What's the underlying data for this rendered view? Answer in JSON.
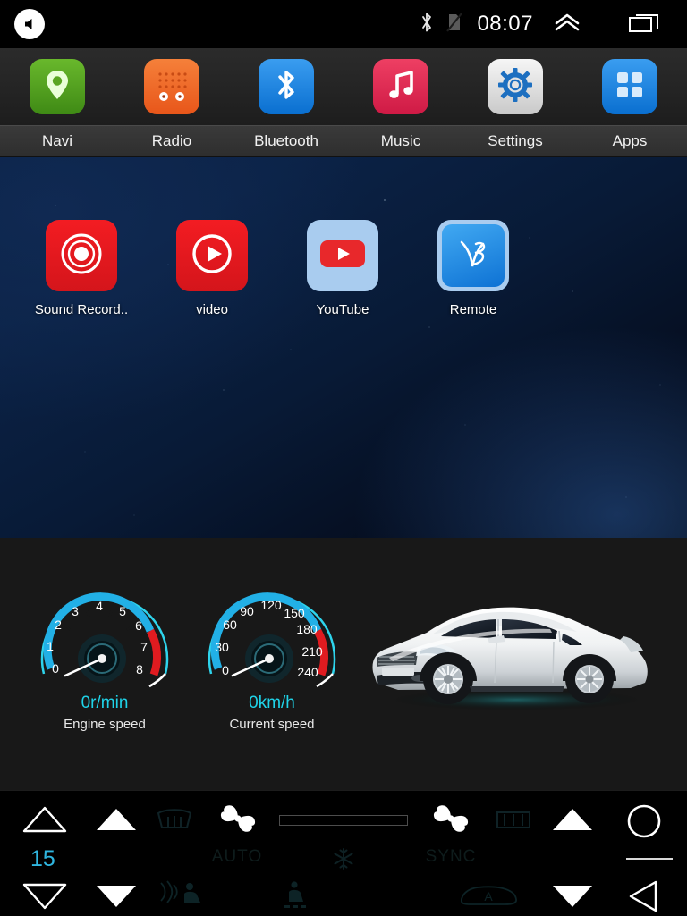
{
  "status_bar": {
    "mute_icon": "volume-muted-icon",
    "bluetooth_icon": "bluetooth-icon",
    "sim_icon": "no-sim-card-icon",
    "time": "08:07",
    "chevron_icon": "double-chevron-up-icon",
    "recents_icon": "recent-apps-icon"
  },
  "app_bar": {
    "items": [
      {
        "label": "Navi",
        "icon": "map-pin-icon",
        "color": "#57a321"
      },
      {
        "label": "Radio",
        "icon": "radio-icon",
        "color": "#ef6a1d"
      },
      {
        "label": "Bluetooth",
        "icon": "bluetooth-icon",
        "color": "#1783e0"
      },
      {
        "label": "Music",
        "icon": "music-note-icon",
        "color": "#e32b55"
      },
      {
        "label": "Settings",
        "icon": "gear-icon",
        "color": "#dcdcdc"
      },
      {
        "label": "Apps",
        "icon": "grid-apps-icon",
        "color": "#1783e0"
      }
    ]
  },
  "desktop": {
    "icons": [
      {
        "label": "Sound Record..",
        "icon": "sound-recorder-icon",
        "color": "#ec1c24"
      },
      {
        "label": "video",
        "icon": "video-player-icon",
        "color": "#ec1c24"
      },
      {
        "label": "YouTube",
        "icon": "youtube-icon",
        "color": "#aacdf0"
      },
      {
        "label": "Remote",
        "icon": "remote-app-icon",
        "color": "#1e90e8"
      }
    ]
  },
  "car_panel": {
    "gauges": [
      {
        "name": "engine-speed-gauge",
        "value": "0r/min",
        "caption": "Engine speed",
        "ticks": [
          "0",
          "1",
          "2",
          "3",
          "4",
          "5",
          "6",
          "7",
          "8"
        ],
        "needle_value": 0,
        "min": 0,
        "max": 8,
        "redline_start": 6,
        "arc_color": "#22b9e8",
        "red_color": "#e01b20"
      },
      {
        "name": "current-speed-gauge",
        "value": "0km/h",
        "caption": "Current speed",
        "ticks": [
          "0",
          "30",
          "60",
          "90",
          "120",
          "150",
          "180",
          "210",
          "240"
        ],
        "needle_value": 0,
        "min": 0,
        "max": 240,
        "redline_start": 180,
        "arc_color": "#22b9e8",
        "red_color": "#e01b20"
      }
    ],
    "vehicle_image": "white-sedan-car-photo"
  },
  "climate_bar": {
    "left_temp_up_icon": "temp-up-outline-icon",
    "left_temp_value": "15",
    "left_temp_down_icon": "temp-down-outline-icon",
    "fan_up_icon": "fan-up-icon",
    "fan_down_icon": "fan-down-icon",
    "front_defrost_icon": "front-defrost-icon",
    "blower_left_icon": "blower-fan-icon",
    "auto_label": "AUTO",
    "ac_icon": "ac-snowflake-icon",
    "airflow_face_icon": "airflow-face-icon",
    "airflow_feet_icon": "airflow-feet-icon",
    "slider_name": "blower-level-slider",
    "blower_right_icon": "blower-fan-icon",
    "sync_label": "SYNC",
    "seat_icon": "seat-icon",
    "rear_defrost_icon": "rear-defrost-icon",
    "recirc_icon": "air-recirculation-icon",
    "right_up_icon": "volume-up-icon",
    "right_down_icon": "volume-down-icon",
    "home_icon": "home-circle-icon",
    "back_icon": "back-triangle-icon"
  }
}
